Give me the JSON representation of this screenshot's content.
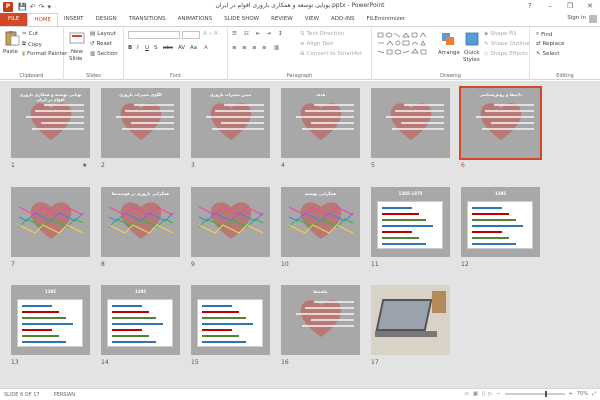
{
  "window": {
    "app_icon": "P",
    "title": "پویایی توسعه و همکاری باروری اقوام در ایران.pptx - PowerPoint",
    "minimize": "–",
    "restore": "❐",
    "close": "✕",
    "help": "?"
  },
  "tabs": [
    {
      "label": "FILE"
    },
    {
      "label": "HOME"
    },
    {
      "label": "INSERT"
    },
    {
      "label": "DESIGN"
    },
    {
      "label": "TRANSITIONS"
    },
    {
      "label": "ANIMATIONS"
    },
    {
      "label": "SLIDE SHOW"
    },
    {
      "label": "REVIEW"
    },
    {
      "label": "VIEW"
    },
    {
      "label": "ADD-INS"
    },
    {
      "label": "FILEminimizer"
    }
  ],
  "signin": "Sign in",
  "ribbon": {
    "clipboard": {
      "label": "Clipboard",
      "paste": "Paste",
      "cut": "Cut",
      "copy": "Copy",
      "format_painter": "Format Painter"
    },
    "slides": {
      "label": "Slides",
      "new_slide": "New",
      "new_slide2": "Slide",
      "layout": "Layout",
      "reset": "Reset",
      "section": "Section"
    },
    "font": {
      "label": "Font"
    },
    "paragraph": {
      "label": "Paragraph",
      "text_direction": "Text Direction",
      "align_text": "Align Text",
      "convert": "Convert to SmartArt"
    },
    "drawing": {
      "label": "Drawing",
      "arrange": "Arrange",
      "quick_styles": "Quick",
      "quick_styles2": "Styles",
      "shape_fill": "Shape Fill",
      "shape_outline": "Shape Outline",
      "shape_effects": "Shape Effects"
    },
    "editing": {
      "label": "Editing",
      "find": "Find",
      "replace": "Replace",
      "select": "Select"
    }
  },
  "slides": [
    {
      "num": "1",
      "title": "پویایی توسعه و همکاری باروری اقوام در ایران",
      "star": "★"
    },
    {
      "num": "2",
      "title": "الگوی تغییرات باروری"
    },
    {
      "num": "3",
      "title": "تبیین تغییرات باروری"
    },
    {
      "num": "4",
      "title": "هدف"
    },
    {
      "num": "5",
      "title": ""
    },
    {
      "num": "6",
      "title": "داده‌ها و روش‌شناسی"
    },
    {
      "num": "7",
      "title": ""
    },
    {
      "num": "8",
      "title": "همگرایی باروری در قومیت‌ها"
    },
    {
      "num": "9",
      "title": ""
    },
    {
      "num": "10",
      "title": "همگرایی توسعه"
    },
    {
      "num": "11",
      "title": "1385-1375"
    },
    {
      "num": "12",
      "title": "1395"
    },
    {
      "num": "13",
      "title": "1385"
    },
    {
      "num": "14",
      "title": "1395"
    },
    {
      "num": "15",
      "title": ""
    },
    {
      "num": "16",
      "title": "یافته‌ها"
    },
    {
      "num": "17",
      "title": ""
    }
  ],
  "status": {
    "slide_of": "SLIDE 6 OF 17",
    "language": "PERSIAN",
    "zoom": "70%"
  }
}
